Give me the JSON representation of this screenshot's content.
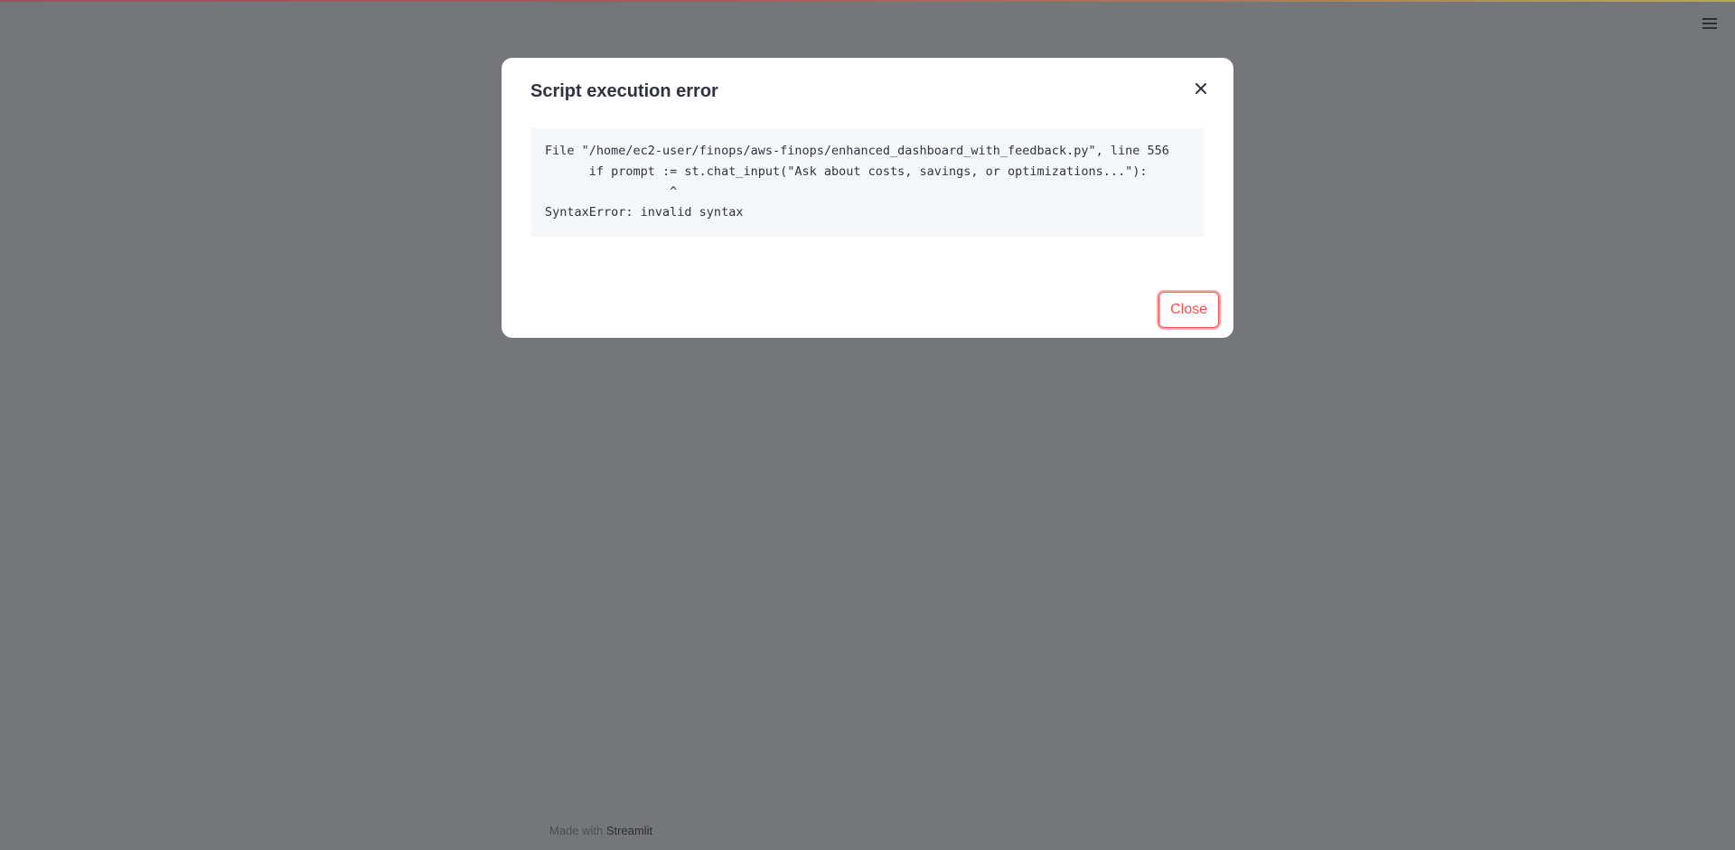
{
  "footer": {
    "made_with": "Made with",
    "brand": "Streamlit"
  },
  "modal": {
    "title": "Script execution error",
    "error_lines": [
      "File \"/home/ec2-user/finops/aws-finops/enhanced_dashboard_with_feedback.py\", line 556",
      "      if prompt := st.chat_input(\"Ask about costs, savings, or optimizations...\"):",
      "                 ^",
      "SyntaxError: invalid syntax"
    ],
    "close_button_label": "Close"
  },
  "icons": {
    "menu": "hamburger-menu-icon",
    "close": "close-icon"
  },
  "colors": {
    "overlay": "#75767a",
    "accent": "#ff4b4b",
    "text": "#31333f",
    "code_background": "#f6f7f9"
  }
}
